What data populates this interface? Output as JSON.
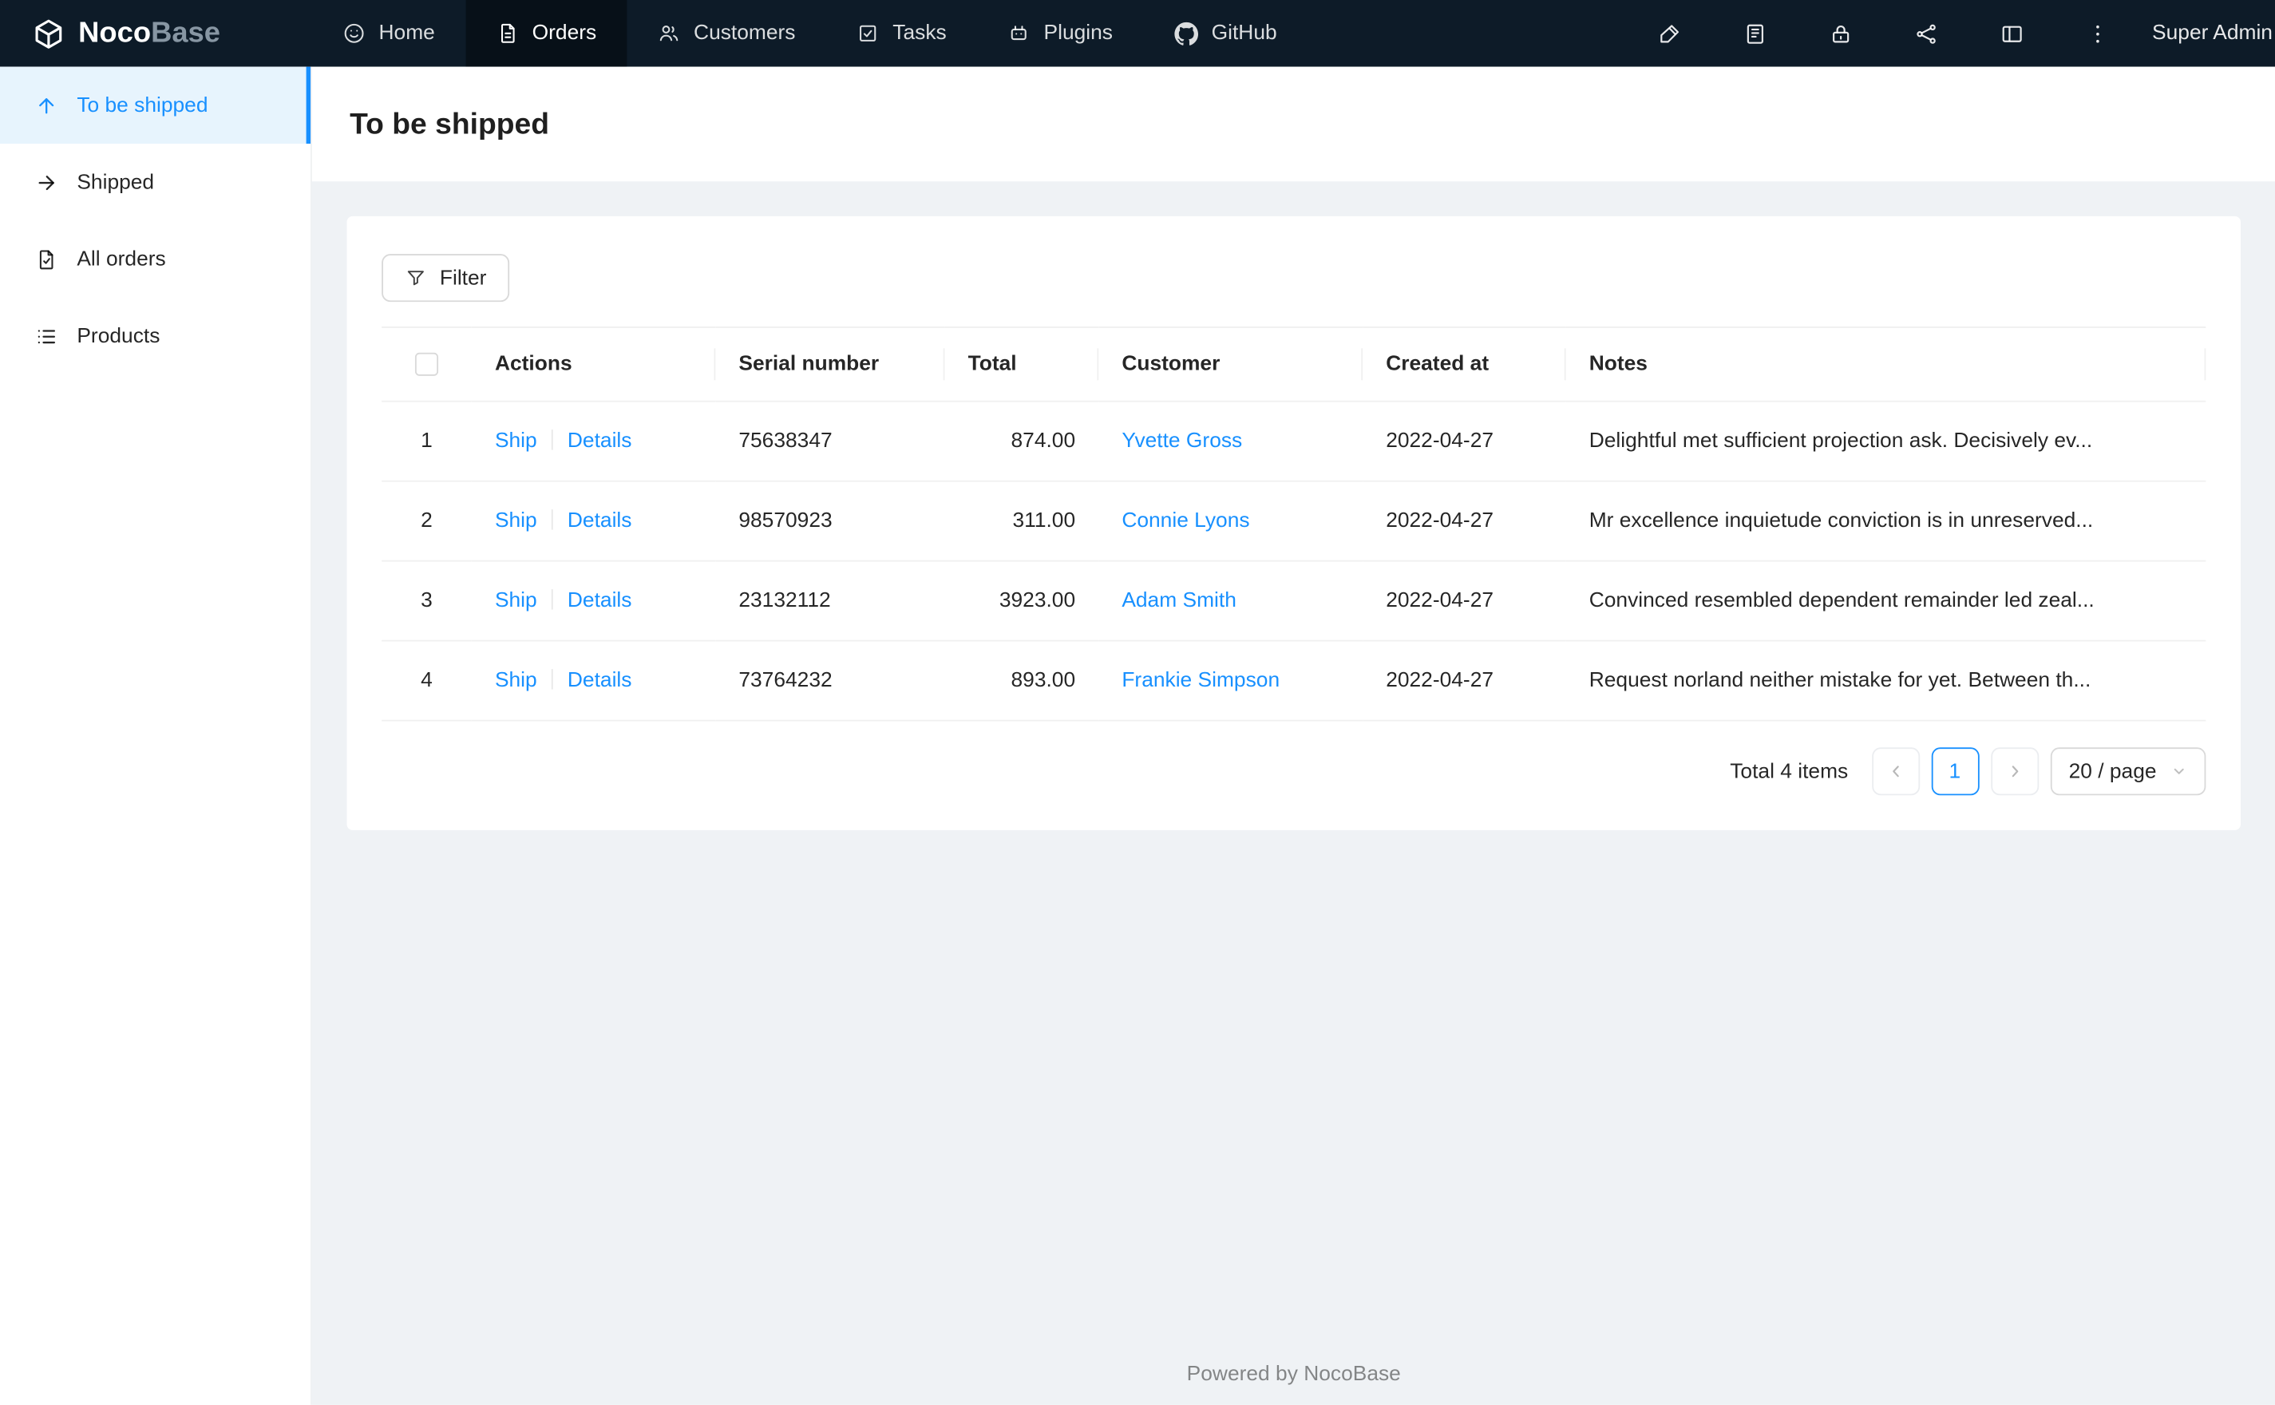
{
  "brand": {
    "noco": "Noco",
    "base": "Base",
    "logo_icon": "cube-logo-icon"
  },
  "topnav": {
    "items": [
      {
        "label": "Home",
        "icon": "smile-icon",
        "active": false
      },
      {
        "label": "Orders",
        "icon": "order-file-icon",
        "active": true
      },
      {
        "label": "Customers",
        "icon": "customers-icon",
        "active": false
      },
      {
        "label": "Tasks",
        "icon": "task-check-icon",
        "active": false
      },
      {
        "label": "Plugins",
        "icon": "robot-icon",
        "active": false
      },
      {
        "label": "GitHub",
        "icon": "github-icon",
        "active": false
      }
    ],
    "action_icons": [
      "highlighter-icon",
      "book-icon",
      "lock-icon",
      "cluster-icon",
      "layout-icon",
      "more-icon"
    ],
    "user": "Super Admin"
  },
  "sidebar": {
    "items": [
      {
        "label": "To be shipped",
        "icon": "arrow-up-icon",
        "active": true
      },
      {
        "label": "Shipped",
        "icon": "arrow-right-icon",
        "active": false
      },
      {
        "label": "All orders",
        "icon": "file-done-icon",
        "active": false
      },
      {
        "label": "Products",
        "icon": "list-icon",
        "active": false
      }
    ]
  },
  "page": {
    "title": "To be shipped"
  },
  "toolbar": {
    "filter": "Filter"
  },
  "table": {
    "columns": [
      "Actions",
      "Serial number",
      "Total",
      "Customer",
      "Created at",
      "Notes"
    ],
    "actions": {
      "ship": "Ship",
      "details": "Details"
    },
    "rows": [
      {
        "index": "1",
        "serial": "75638347",
        "total": "874.00",
        "customer": "Yvette Gross",
        "created_at": "2022-04-27",
        "notes": "Delightful met sufficient projection ask. Decisively ev..."
      },
      {
        "index": "2",
        "serial": "98570923",
        "total": "311.00",
        "customer": "Connie Lyons",
        "created_at": "2022-04-27",
        "notes": "Mr excellence inquietude conviction is in unreserved..."
      },
      {
        "index": "3",
        "serial": "23132112",
        "total": "3923.00",
        "customer": "Adam Smith",
        "created_at": "2022-04-27",
        "notes": "Convinced resembled dependent remainder led zeal..."
      },
      {
        "index": "4",
        "serial": "73764232",
        "total": "893.00",
        "customer": "Frankie Simpson",
        "created_at": "2022-04-27",
        "notes": "Request norland neither mistake for yet. Between th..."
      }
    ]
  },
  "pagination": {
    "total": "Total 4 items",
    "page": "1",
    "size": "20 / page"
  },
  "footer": {
    "text": "Powered by NocoBase"
  },
  "colors": {
    "accent": "#1890ff",
    "header_bg": "#0d1b28",
    "header_active_bg": "#071018",
    "sidebar_active_bg": "#e7f4fd",
    "content_bg": "#eff2f5"
  }
}
